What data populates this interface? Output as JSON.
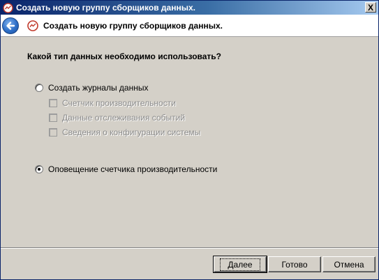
{
  "window": {
    "title": "Создать новую группу сборщиков данных.",
    "close_label": "X"
  },
  "header": {
    "title": "Создать новую группу сборщиков данных."
  },
  "main": {
    "question": "Какой тип данных необходимо использовать?",
    "options": [
      {
        "label": "Создать журналы данных",
        "selected": false
      },
      {
        "label": "Оповещение счетчика производительности",
        "selected": true
      }
    ],
    "sub_options": [
      {
        "label": "Счетчик производительности",
        "checked": false,
        "enabled": false
      },
      {
        "label": "Данные отслеживания событий",
        "checked": false,
        "enabled": false
      },
      {
        "label": "Сведения о конфигурации системы",
        "checked": false,
        "enabled": false
      }
    ]
  },
  "buttons": {
    "next": "Далее",
    "finish": "Готово",
    "cancel": "Отмена"
  },
  "colors": {
    "dialog_bg": "#d4d0c8",
    "titlebar_start": "#0a246a",
    "titlebar_end": "#a6caf0",
    "disabled_text": "#8c8c8c"
  }
}
